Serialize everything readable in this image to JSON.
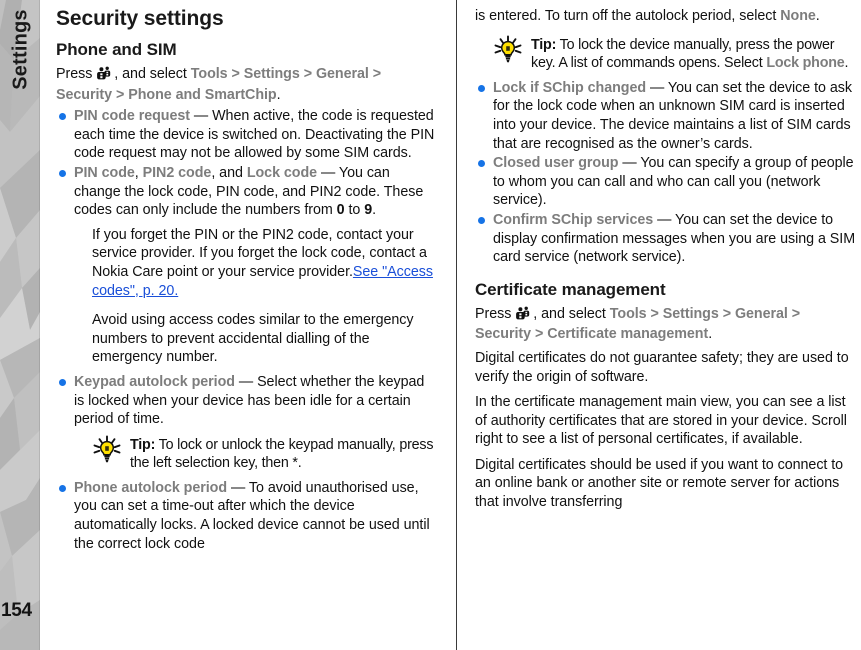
{
  "sidebar": {
    "chapter_label": "Settings",
    "page_number": "154"
  },
  "icons": {
    "menu_key": "menu-key-icon",
    "tip_bulb": "lightbulb-tip-icon"
  },
  "colors": {
    "ui_label": "#7d7d7d",
    "bullet": "#1673e6",
    "link": "#1a4fd8",
    "sidebar_bg": "#b9b9b9",
    "tip_bulb": "#ffe000"
  },
  "left_column": {
    "title": "Security settings",
    "subtitle": "Phone and SIM",
    "path_intro": {
      "press": "Press",
      "and_select": ", and select",
      "crumbs": [
        "Tools",
        "Settings",
        "General",
        "Security",
        "Phone and SmartChip"
      ],
      "separator": ">",
      "period": "."
    },
    "bullets": [
      {
        "label": "PIN code request",
        "dash": " — ",
        "text": "When active, the code is requested each time the device is switched on. Deactivating the PIN code request may not be allowed by some SIM cards."
      },
      {
        "label_parts": [
          "PIN code",
          "PIN2 code",
          "Lock code"
        ],
        "label_joiner_1": ", ",
        "label_joiner_2": ", and ",
        "dash": " — ",
        "text_a": "You can change the lock code, PIN code, and PIN2 code. These codes can only include the numbers from ",
        "num_from": "0",
        "text_b": " to ",
        "num_to": "9",
        "text_c": ".",
        "sub_paragraphs": [
          {
            "text_a": "If you forget the PIN or the PIN2 code, contact your service provider. If you forget the lock code, contact a Nokia Care point or your service provider.",
            "link": "See \"Access codes\", p. 20."
          },
          {
            "text_a": "Avoid using access codes similar to the emergency numbers to prevent accidental dialling of the emergency number.",
            "link": ""
          }
        ]
      },
      {
        "label": "Keypad autolock period",
        "dash": " — ",
        "text": "Select whether the keypad is locked when your device has been idle for a certain period of time."
      },
      {
        "label": "Phone autolock period",
        "dash": " — ",
        "text": "To avoid unauthorised use, you can set a time-out after which the device automatically locks. A locked device cannot be used until the correct lock code"
      }
    ],
    "tip": {
      "label": "Tip:",
      "text": " To lock or unlock the keypad manually, press the left selection key, then *."
    }
  },
  "right_column": {
    "continuation": {
      "text_a": "is entered. To turn off the autolock period, select ",
      "ui": "None",
      "text_b": "."
    },
    "tip": {
      "label": "Tip:",
      "text_a": " To lock the device manually, press the power key. A list of commands opens. Select ",
      "ui": "Lock phone",
      "text_b": "."
    },
    "bullets": [
      {
        "label": "Lock if SChip changed",
        "dash": " — ",
        "text": "You can set the device to ask for the lock code when an unknown SIM card is inserted into your device. The device maintains a list of SIM cards that are recognised as the owner’s cards."
      },
      {
        "label": "Closed user group",
        "dash": " — ",
        "text": "You can specify a group of people to whom you can call and who can call you (network service)."
      },
      {
        "label": "Confirm SChip services",
        "dash": " — ",
        "text": "You can set the device to display confirmation messages when you are using a SIM card service (network service)."
      }
    ],
    "section_title": "Certificate management",
    "path_intro": {
      "press": "Press",
      "and_select": ", and select",
      "crumbs": [
        "Tools",
        "Settings",
        "General",
        "Security",
        "Certificate management"
      ],
      "separator": ">",
      "period": "."
    },
    "paragraphs": [
      "Digital certificates do not guarantee safety; they are used to verify the origin of software.",
      "In the certificate management main view, you can see a list of authority certificates that are stored in your device. Scroll right to see a list of personal certificates, if available.",
      "Digital certificates should be used if you want to connect to an online bank or another site or remote server for actions that involve transferring"
    ]
  }
}
